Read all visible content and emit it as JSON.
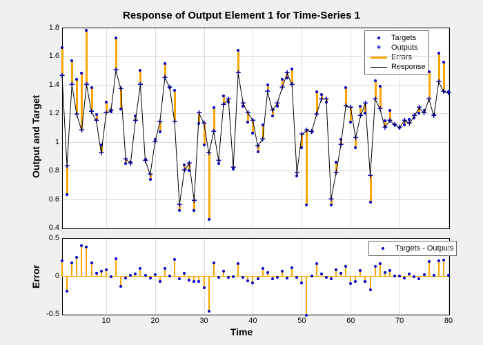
{
  "title": "Response of Output Element 1 for Time-Series 1",
  "ylabel1": "Output and Target",
  "ylabel2": "Error",
  "xlabel": "Time",
  "legend1": {
    "targets": "Targets",
    "outputs": "Outputs",
    "errors": "Errors",
    "response": "Response"
  },
  "legend2": {
    "diff": "Targets - Outputs"
  },
  "ticks": {
    "y1": [
      "1.8",
      "1.6",
      "1.4",
      "1.2",
      "1",
      "0.8",
      "0.6",
      "0.4"
    ],
    "y2": [
      "0.5",
      "0",
      "-0.5"
    ],
    "x": [
      "10",
      "20",
      "30",
      "40",
      "50",
      "60",
      "70",
      "80"
    ]
  },
  "chart_data": {
    "type": "line",
    "title": "Response of Output Element 1 for Time-Series 1",
    "xlabel": "Time",
    "ylabel": "Output and Target",
    "ylim1": [
      0.4,
      1.8
    ],
    "ylim2": [
      -0.5,
      0.5
    ],
    "x": [
      1,
      2,
      3,
      4,
      5,
      6,
      7,
      8,
      9,
      10,
      11,
      12,
      13,
      14,
      15,
      16,
      17,
      18,
      19,
      20,
      21,
      22,
      23,
      24,
      25,
      26,
      27,
      28,
      29,
      30,
      31,
      32,
      33,
      34,
      35,
      36,
      37,
      38,
      39,
      40,
      41,
      42,
      43,
      44,
      45,
      46,
      47,
      48,
      49,
      50,
      51,
      52,
      53,
      54,
      55,
      56,
      57,
      58,
      59,
      60,
      61,
      62,
      63,
      64,
      65,
      66,
      67,
      68,
      69,
      70,
      71,
      72,
      73,
      74,
      75,
      76,
      77,
      78,
      79,
      80
    ],
    "series": [
      {
        "name": "Targets",
        "values": [
          1.66,
          0.63,
          1.57,
          1.44,
          1.48,
          1.78,
          1.38,
          1.19,
          0.98,
          1.28,
          1.21,
          1.73,
          1.23,
          0.85,
          0.86,
          1.18,
          1.5,
          0.88,
          0.74,
          1.02,
          1.07,
          1.55,
          1.38,
          1.36,
          0.52,
          0.84,
          0.8,
          0.52,
          1.13,
          0.98,
          0.46,
          1.24,
          0.85,
          1.32,
          1.28,
          0.81,
          1.64,
          1.25,
          1.14,
          1.06,
          0.93,
          1.12,
          1.4,
          1.18,
          1.25,
          1.44,
          1.45,
          1.51,
          0.76,
          0.96,
          0.56,
          1.07,
          1.35,
          1.33,
          1.28,
          0.56,
          0.86,
          1.02,
          1.38,
          1.14,
          0.96,
          1.25,
          1.2,
          0.58,
          1.43,
          1.39,
          1.15,
          1.22,
          1.12,
          1.1,
          1.12,
          1.16,
          1.17,
          1.2,
          1.22,
          1.49,
          1.19,
          1.62,
          1.56,
          1.35
        ],
        "marker": "dot",
        "color": "#0000c8"
      },
      {
        "name": "Outputs",
        "values": [
          1.46,
          0.83,
          1.4,
          1.19,
          1.08,
          1.4,
          1.21,
          1.15,
          0.92,
          1.2,
          1.22,
          1.5,
          1.37,
          0.88,
          0.85,
          1.15,
          1.4,
          0.87,
          0.77,
          1.0,
          1.14,
          1.45,
          1.38,
          1.14,
          0.56,
          0.8,
          0.85,
          0.59,
          1.2,
          1.13,
          0.92,
          1.07,
          0.87,
          1.26,
          1.3,
          0.82,
          1.48,
          1.27,
          1.2,
          1.15,
          0.97,
          1.02,
          1.35,
          1.22,
          1.27,
          1.38,
          1.48,
          1.4,
          0.78,
          1.05,
          1.08,
          1.07,
          1.19,
          1.3,
          1.3,
          0.6,
          0.78,
          0.98,
          1.25,
          1.24,
          1.03,
          1.18,
          1.27,
          0.76,
          1.3,
          1.23,
          1.1,
          1.15,
          1.12,
          1.1,
          1.15,
          1.13,
          1.18,
          1.24,
          1.2,
          1.3,
          1.18,
          1.42,
          1.35,
          1.34
        ],
        "marker": "plus",
        "color": "#0000c8"
      },
      {
        "name": "Errors",
        "derived": "Targets - Outputs",
        "color": "#ffa500"
      },
      {
        "name": "Response",
        "link": "Outputs",
        "color": "#000000",
        "style": "line"
      }
    ],
    "errors": [
      0.2,
      -0.2,
      0.17,
      0.25,
      0.4,
      0.38,
      0.17,
      0.04,
      0.06,
      0.08,
      -0.01,
      0.23,
      -0.14,
      -0.03,
      0.01,
      0.03,
      0.1,
      0.01,
      -0.03,
      0.02,
      -0.07,
      0.1,
      0.0,
      0.22,
      -0.04,
      0.04,
      -0.05,
      -0.07,
      -0.07,
      -0.15,
      -0.46,
      0.17,
      -0.02,
      0.06,
      -0.02,
      -0.01,
      0.16,
      -0.02,
      -0.06,
      -0.09,
      -0.04,
      0.1,
      0.05,
      -0.04,
      -0.02,
      0.06,
      -0.03,
      0.11,
      -0.02,
      -0.09,
      -0.52,
      0.0,
      0.16,
      0.03,
      -0.02,
      -0.04,
      0.08,
      0.04,
      0.13,
      -0.1,
      -0.07,
      0.07,
      -0.07,
      -0.18,
      0.13,
      0.16,
      0.05,
      0.07,
      0.0,
      0.0,
      -0.03,
      0.03,
      -0.01,
      -0.04,
      0.02,
      0.19,
      0.01,
      0.2,
      0.21,
      0.01
    ]
  }
}
